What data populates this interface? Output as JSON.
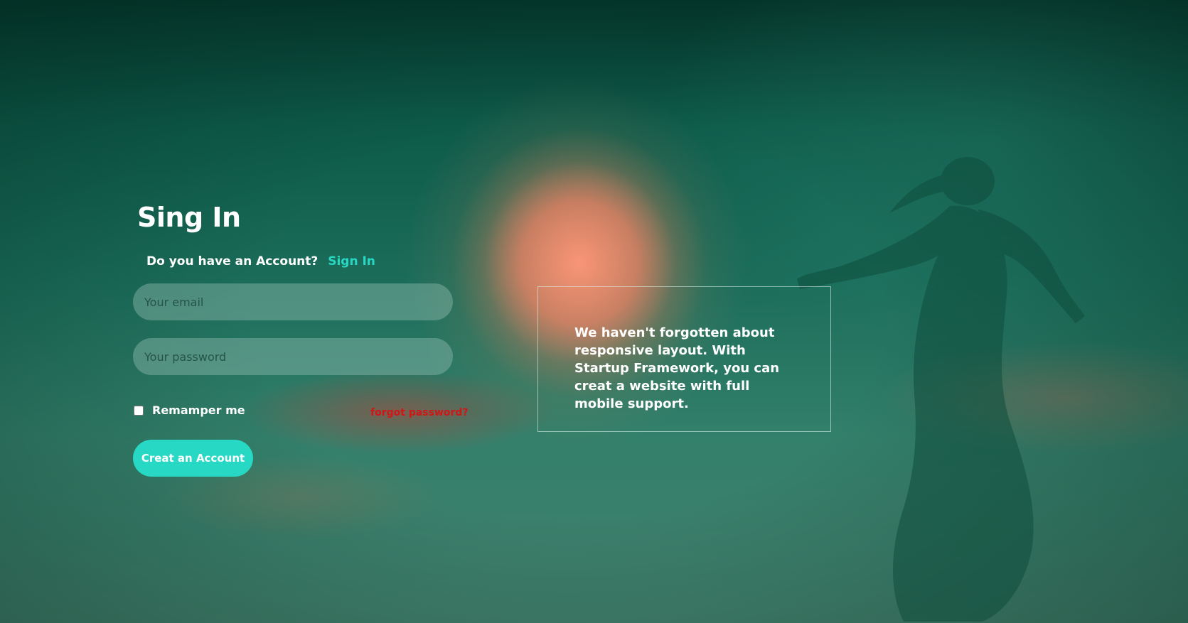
{
  "title": "Sing In",
  "account_prompt": "Do you have an Account?",
  "signin_link": "Sign In",
  "email_placeholder": "Your email",
  "password_placeholder": "Your password",
  "remember_label": "Remamper me",
  "remember_checked": false,
  "forgot_link": "forgot password?",
  "create_button": "Creat an Account",
  "info_text": "We haven't forgotten about responsive layout. With Startup Framework, you can creat a website with full mobile support.",
  "colors": {
    "accent": "#27d9c4",
    "forgot": "#d01616",
    "background": "#2f7560",
    "text": "#ffffff"
  }
}
